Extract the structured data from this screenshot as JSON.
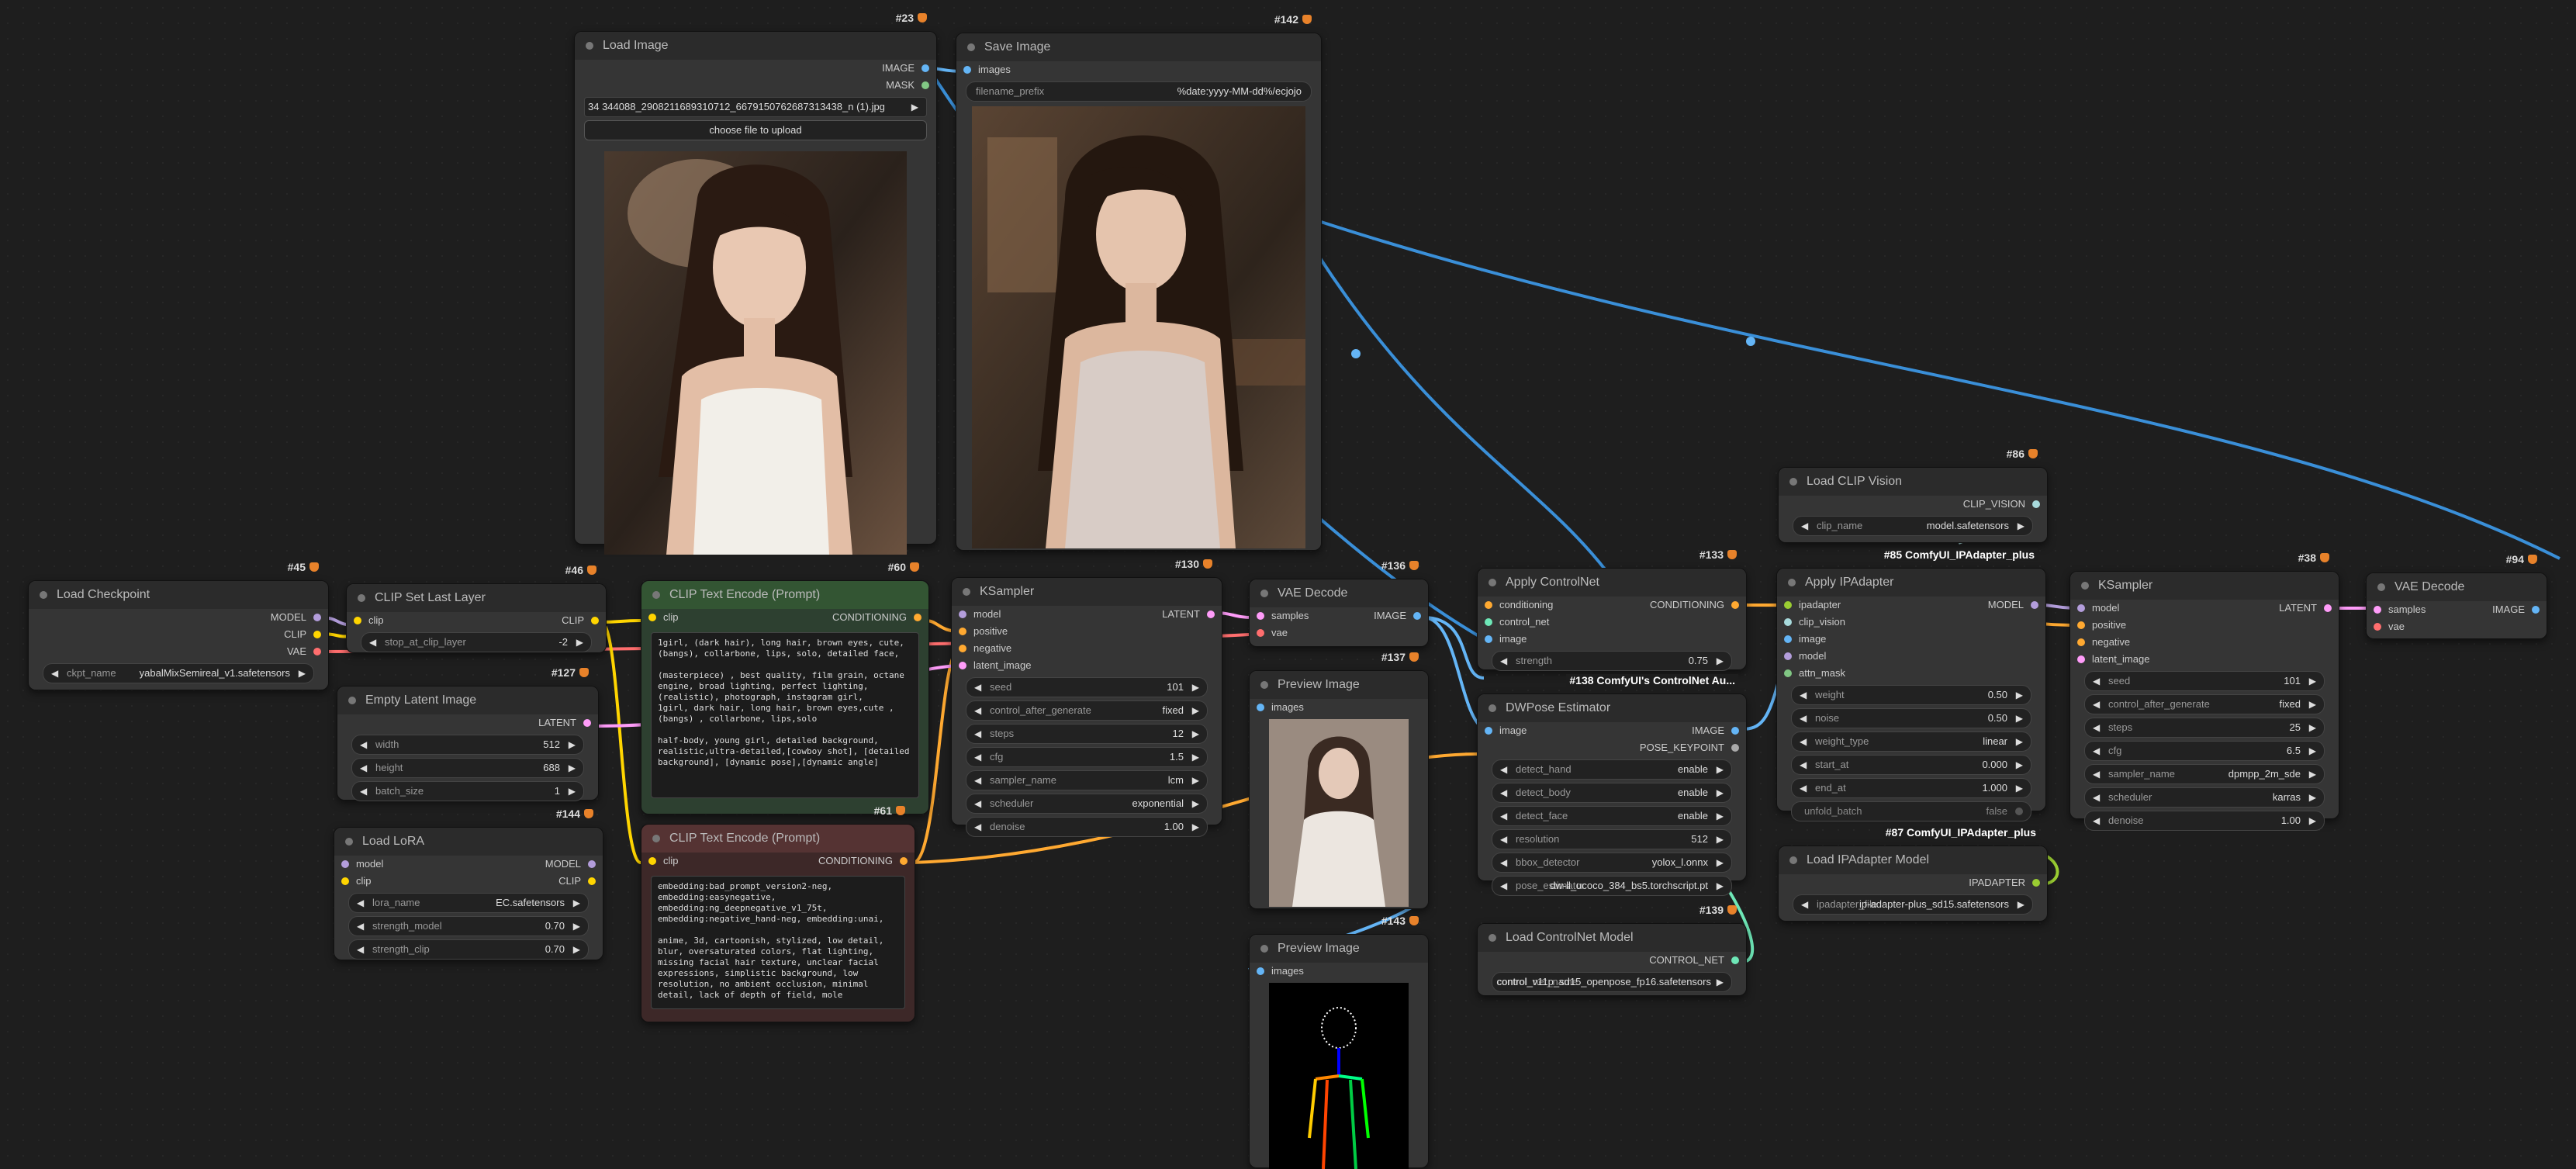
{
  "nodes": {
    "load_image": {
      "id": "#23",
      "title": "Load Image",
      "outputs": [
        "IMAGE",
        "MASK"
      ],
      "filename": "34 344088_2908211689310712_6679150762687313438_n (1).jpg",
      "upload_label": "choose file to upload"
    },
    "save_image": {
      "id": "#142",
      "title": "Save Image",
      "input": "images",
      "prefix_label": "filename_prefix",
      "prefix_value": "%date:yyyy-MM-dd%/ecjojo"
    },
    "load_checkpoint": {
      "id": "#45",
      "title": "Load Checkpoint",
      "outputs": [
        "MODEL",
        "CLIP",
        "VAE"
      ],
      "ckpt_label": "ckpt_name",
      "ckpt_value": "yabalMixSemireal_v1.safetensors"
    },
    "clip_set_last_layer": {
      "id": "#46",
      "title": "CLIP Set Last Layer",
      "input": "clip",
      "output": "CLIP",
      "w_label": "stop_at_clip_layer",
      "w_value": "-2"
    },
    "empty_latent": {
      "id": "#127",
      "title": "Empty Latent Image",
      "output": "LATENT",
      "widgets": [
        {
          "label": "width",
          "value": "512"
        },
        {
          "label": "height",
          "value": "688"
        },
        {
          "label": "batch_size",
          "value": "1"
        }
      ]
    },
    "load_lora": {
      "id": "#144",
      "title": "Load LoRA",
      "inputs": [
        "model",
        "clip"
      ],
      "outputs": [
        "MODEL",
        "CLIP"
      ],
      "widgets": [
        {
          "label": "lora_name",
          "value": "EC.safetensors"
        },
        {
          "label": "strength_model",
          "value": "0.70"
        },
        {
          "label": "strength_clip",
          "value": "0.70"
        }
      ]
    },
    "clip_pos": {
      "id": "#60",
      "title": "CLIP Text Encode (Prompt)",
      "input": "clip",
      "output": "CONDITIONING",
      "text": "1girl, (dark hair), long hair, brown eyes, cute,(bangs), collarbone, lips, solo, detailed face,\n\n(masterpiece) , best quality, film grain, octane engine, broad lighting, perfect lighting,(realistic), photograph, instagram girl,\n1girl, dark hair, long hair, brown eyes,cute ,(bangs) , collarbone, lips,solo\n\nhalf-body, young girl, detailed background, realistic,ultra-detailed,[cowboy shot], [detailed background], [dynamic pose],[dynamic angle]"
    },
    "clip_neg": {
      "id": "#61",
      "title": "CLIP Text Encode (Prompt)",
      "input": "clip",
      "output": "CONDITIONING",
      "text": "embedding:bad_prompt_version2-neg,\nembedding:easynegative,\nembedding:ng_deepnegative_v1_75t,\nembedding:negative_hand-neg, embedding:unai,\n\nanime, 3d, cartoonish, stylized, low detail, blur, oversaturated colors, flat lighting, missing facial hair texture, unclear facial expressions, simplistic background, low resolution, no ambient occlusion, minimal detail, lack of depth of field, mole"
    },
    "ksampler1": {
      "id": "#130",
      "title": "KSampler",
      "inputs": [
        "model",
        "positive",
        "negative",
        "latent_image"
      ],
      "output": "LATENT",
      "widgets": [
        {
          "label": "seed",
          "value": "101"
        },
        {
          "label": "control_after_generate",
          "value": "fixed"
        },
        {
          "label": "steps",
          "value": "12"
        },
        {
          "label": "cfg",
          "value": "1.5"
        },
        {
          "label": "sampler_name",
          "value": "lcm"
        },
        {
          "label": "scheduler",
          "value": "exponential"
        },
        {
          "label": "denoise",
          "value": "1.00"
        }
      ]
    },
    "vae_decode1": {
      "id": "#136",
      "title": "VAE Decode",
      "inputs": [
        "samples",
        "vae"
      ],
      "output": "IMAGE"
    },
    "preview1": {
      "id": "#137",
      "title": "Preview Image",
      "input": "images"
    },
    "preview2": {
      "id": "#143",
      "title": "Preview Image",
      "input": "images"
    },
    "apply_controlnet": {
      "id": "#133",
      "title": "Apply ControlNet",
      "inputs": [
        "conditioning",
        "control_net",
        "image"
      ],
      "output": "CONDITIONING",
      "w_label": "strength",
      "w_value": "0.75"
    },
    "dwpose": {
      "id": "#138 ComfyUI's ControlNet Au...",
      "title": "DWPose Estimator",
      "input": "image",
      "outputs": [
        "IMAGE",
        "POSE_KEYPOINT"
      ],
      "widgets": [
        {
          "label": "detect_hand",
          "value": "enable"
        },
        {
          "label": "detect_body",
          "value": "enable"
        },
        {
          "label": "detect_face",
          "value": "enable"
        },
        {
          "label": "resolution",
          "value": "512"
        },
        {
          "label": "bbox_detector",
          "value": "yolox_l.onnx"
        },
        {
          "label": "pose_estimator",
          "value": "dw-ll_ucoco_384_bs5.torchscript.pt"
        }
      ]
    },
    "load_controlnet": {
      "id": "#139",
      "title": "Load ControlNet Model",
      "output": "CONTROL_NET",
      "w_label": "control_net_name",
      "w_value": "control_v11p_sd15_openpose_fp16.safetensors"
    },
    "load_clip_vision": {
      "id": "#86",
      "title": "Load CLIP Vision",
      "output": "CLIP_VISION",
      "w_label": "clip_name",
      "w_value": "model.safetensors"
    },
    "apply_ipadapter": {
      "id": "#85 ComfyUI_IPAdapter_plus",
      "title": "Apply IPAdapter",
      "inputs": [
        "ipadapter",
        "clip_vision",
        "image",
        "model",
        "attn_mask"
      ],
      "output": "MODEL",
      "widgets": [
        {
          "label": "weight",
          "value": "0.50"
        },
        {
          "label": "noise",
          "value": "0.50"
        },
        {
          "label": "weight_type",
          "value": "linear"
        },
        {
          "label": "start_at",
          "value": "0.000"
        },
        {
          "label": "end_at",
          "value": "1.000"
        }
      ],
      "toggle_label": "unfold_batch",
      "toggle_value": "false"
    },
    "load_ipadapter": {
      "id": "#87 ComfyUI_IPAdapter_plus",
      "title": "Load IPAdapter Model",
      "output": "IPADAPTER",
      "w_label": "ipadapter_file",
      "w_value": "ip-adapter-plus_sd15.safetensors"
    },
    "ksampler2": {
      "id": "#38",
      "title": "KSampler",
      "inputs": [
        "model",
        "positive",
        "negative",
        "latent_image"
      ],
      "output": "LATENT",
      "widgets": [
        {
          "label": "seed",
          "value": "101"
        },
        {
          "label": "control_after_generate",
          "value": "fixed"
        },
        {
          "label": "steps",
          "value": "25"
        },
        {
          "label": "cfg",
          "value": "6.5"
        },
        {
          "label": "sampler_name",
          "value": "dpmpp_2m_sde"
        },
        {
          "label": "scheduler",
          "value": "karras"
        },
        {
          "label": "denoise",
          "value": "1.00"
        }
      ]
    },
    "vae_decode2": {
      "id": "#94",
      "title": "VAE Decode",
      "inputs": [
        "samples",
        "vae"
      ],
      "output": "IMAGE"
    }
  },
  "colors": {
    "model": "#b39ddb",
    "clip": "#ffd500",
    "vae": "#ff6e6e",
    "conditioning": "#ffa931",
    "latent": "#ff9cf9",
    "image": "#64b5f6",
    "mask": "#81c784",
    "control_net": "#6ee7b7",
    "canvas": "#1e1e1e",
    "node": "#353535"
  }
}
